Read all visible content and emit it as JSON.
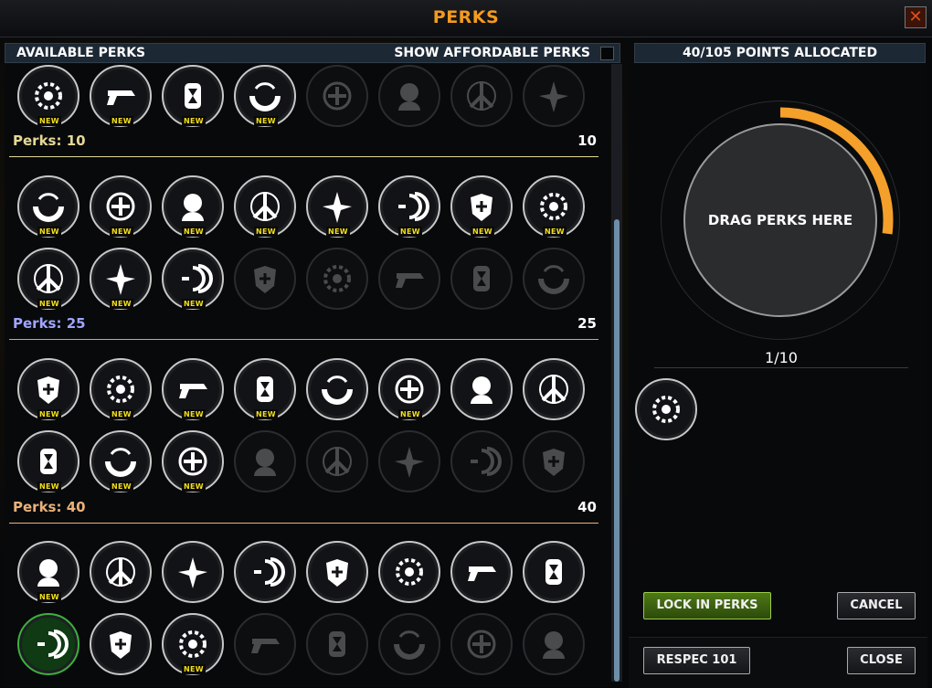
{
  "window": {
    "title": "PERKS",
    "close_icon": "close-icon"
  },
  "left_header": {
    "label": "AVAILABLE PERKS",
    "affordable_label": "SHOW AFFORDABLE PERKS",
    "affordable_checked": false
  },
  "right_header": {
    "label": "40/105 POINTS ALLOCATED"
  },
  "new_badge": "NEW",
  "sections": [
    {
      "label": "Perks: 10",
      "cost": "10",
      "color": "#e4d896"
    },
    {
      "label": "Perks: 25",
      "cost": "25",
      "color": "#a0a6ff"
    },
    {
      "label": "Perks: 40",
      "cost": "40",
      "color": "#e8b27a"
    }
  ],
  "perk_rows": [
    {
      "section": -1,
      "perks": [
        {
          "icon": "gear-icon",
          "state": "available",
          "new": true
        },
        {
          "icon": "pistol-icon",
          "state": "available",
          "new": true
        },
        {
          "icon": "hourglass-icon",
          "state": "available",
          "new": true
        },
        {
          "icon": "shield-arc-icon",
          "state": "available",
          "new": true
        },
        {
          "icon": "cross-target-icon",
          "state": "locked",
          "new": false
        },
        {
          "icon": "head-target-icon",
          "state": "locked",
          "new": false
        },
        {
          "icon": "peace-icon",
          "state": "locked",
          "new": false
        },
        {
          "icon": "trident-icon",
          "state": "locked",
          "new": false
        }
      ]
    },
    {
      "section": 0,
      "perks": [
        {
          "icon": "hourglass-cross-icon",
          "state": "available",
          "new": true
        },
        {
          "icon": "armor-plus-icon",
          "state": "available",
          "new": true
        },
        {
          "icon": "sonic-icon",
          "state": "available",
          "new": true
        },
        {
          "icon": "shield-swipe-icon",
          "state": "available",
          "new": true
        },
        {
          "icon": "grenade-icon",
          "state": "available",
          "new": true
        },
        {
          "icon": "stopwatch-head-icon",
          "state": "available",
          "new": true
        },
        {
          "icon": "jaws-icon",
          "state": "available",
          "new": true
        },
        {
          "icon": "squad-icon",
          "state": "available",
          "new": true
        }
      ]
    },
    {
      "section": -1,
      "perks": [
        {
          "icon": "runner-icon",
          "state": "available",
          "new": true
        },
        {
          "icon": "head-aperture-icon",
          "state": "available",
          "new": true
        },
        {
          "icon": "turret-plus-icon",
          "state": "available",
          "new": true
        },
        {
          "icon": "stopwatch-icon",
          "state": "locked",
          "new": false
        },
        {
          "icon": "globe-wave-icon",
          "state": "locked",
          "new": false
        },
        {
          "icon": "chevrons-icon",
          "state": "locked",
          "new": false
        },
        {
          "icon": "heart-burst-icon",
          "state": "locked",
          "new": false
        },
        {
          "icon": "hand-icon",
          "state": "locked",
          "new": false
        }
      ]
    },
    {
      "section": 1,
      "perks": [
        {
          "icon": "map-icon",
          "state": "available",
          "new": true
        },
        {
          "icon": "medic-icon",
          "state": "available",
          "new": true
        },
        {
          "icon": "warning-icon",
          "state": "available",
          "new": true
        },
        {
          "icon": "crosshair-icon",
          "state": "available",
          "new": true
        },
        {
          "icon": "radar-icon",
          "state": "available",
          "new": false
        },
        {
          "icon": "bow-icon",
          "state": "available",
          "new": true
        },
        {
          "icon": "fire-body-icon",
          "state": "available",
          "new": false
        },
        {
          "icon": "dial-icon",
          "state": "available",
          "new": false
        }
      ]
    },
    {
      "section": -1,
      "perks": [
        {
          "icon": "ammo-plus-icon",
          "state": "available",
          "new": true
        },
        {
          "icon": "pistol-swipe-icon",
          "state": "available",
          "new": true
        },
        {
          "icon": "claw-icon",
          "state": "available",
          "new": true
        },
        {
          "icon": "arrow-circle-icon",
          "state": "locked",
          "new": false
        },
        {
          "icon": "knife-icon",
          "state": "locked",
          "new": false
        },
        {
          "icon": "skull-icon",
          "state": "locked",
          "new": false
        },
        {
          "icon": "terrain-icon",
          "state": "locked",
          "new": false
        },
        {
          "icon": "eye-wave-icon",
          "state": "locked",
          "new": false
        }
      ]
    },
    {
      "section": 2,
      "perks": [
        {
          "icon": "nodes-icon",
          "state": "available",
          "new": true
        },
        {
          "icon": "ring-plus-icon",
          "state": "available",
          "new": false
        },
        {
          "icon": "starburst-icon",
          "state": "available",
          "new": false
        },
        {
          "icon": "ring-cross-icon",
          "state": "available",
          "new": false
        },
        {
          "icon": "tower-icon",
          "state": "available",
          "new": false
        },
        {
          "icon": "orbit-icon",
          "state": "available",
          "new": false
        },
        {
          "icon": "armor-icon",
          "state": "available",
          "new": false
        },
        {
          "icon": "stopwatch-plus-icon",
          "state": "available",
          "new": false
        }
      ]
    },
    {
      "section": -1,
      "perks": [
        {
          "icon": "fury-icon",
          "state": "selected",
          "new": false
        },
        {
          "icon": "split-head-icon",
          "state": "available",
          "new": false
        },
        {
          "icon": "turret-wave-icon",
          "state": "available",
          "new": true
        },
        {
          "icon": "burst-icon",
          "state": "locked",
          "new": false
        },
        {
          "icon": "radio-icon",
          "state": "locked",
          "new": false
        },
        {
          "icon": "planet-icon",
          "state": "locked",
          "new": false
        },
        {
          "icon": "dots-ring-icon",
          "state": "locked",
          "new": false
        },
        {
          "icon": "spiral-icon",
          "state": "locked",
          "new": false
        }
      ]
    }
  ],
  "drop_zone": {
    "label": "DRAG PERKS HERE",
    "fill": 0.27,
    "accent": "#f4a02a"
  },
  "slots": {
    "count": "1/10",
    "equipped": [
      {
        "icon": "fury-icon"
      }
    ]
  },
  "buttons": {
    "lock_in": "LOCK IN PERKS",
    "cancel": "CANCEL",
    "respec": "RESPEC 101",
    "close": "CLOSE"
  }
}
